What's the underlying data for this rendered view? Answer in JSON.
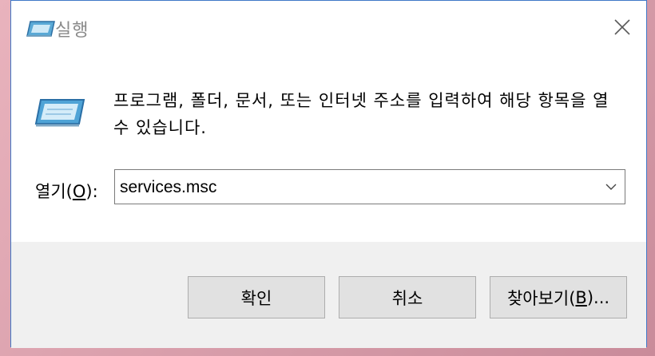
{
  "window": {
    "title": "실행",
    "close_glyph": "✕"
  },
  "content": {
    "description": "프로그램, 폴더, 문서, 또는 인터넷 주소를 입력하여 해당 항목을 열 수 있습니다.",
    "open_label_prefix": "열기(",
    "open_label_key": "O",
    "open_label_suffix": "):",
    "open_value": "services.msc"
  },
  "buttons": {
    "ok": "확인",
    "cancel": "취소",
    "browse_prefix": "찾아보기(",
    "browse_key": "B",
    "browse_suffix": ")..."
  },
  "colors": {
    "window_border": "#3f78c8",
    "footer_bg": "#f0f0f0",
    "button_bg": "#e1e1e1"
  }
}
